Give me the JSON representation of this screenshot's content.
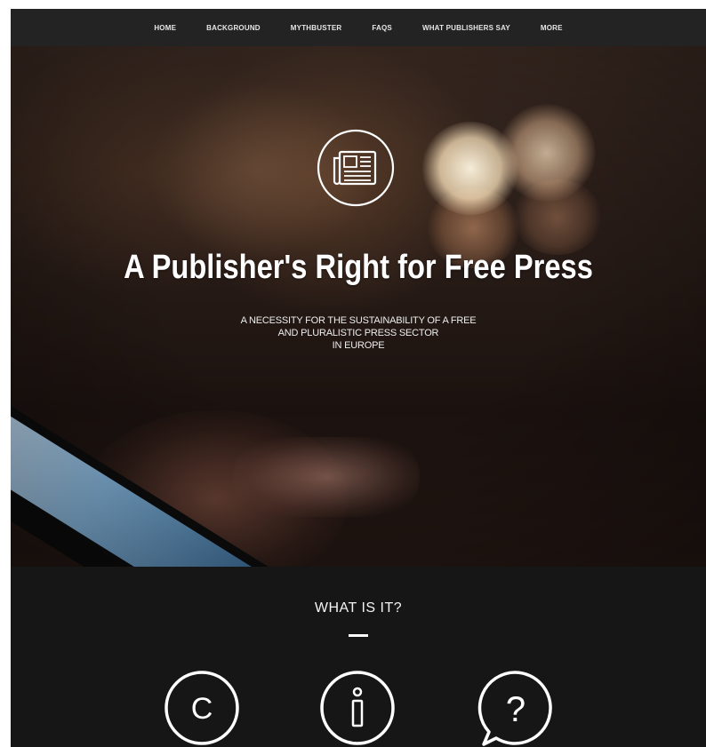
{
  "nav": {
    "items": [
      {
        "label": "HOME"
      },
      {
        "label": "BACKGROUND"
      },
      {
        "label": "MYTHBUSTER"
      },
      {
        "label": "FAQs"
      },
      {
        "label": "WHAT PUBLISHERS SAY"
      },
      {
        "label": "More"
      }
    ]
  },
  "hero": {
    "title": "A Publisher's Right for Free Press",
    "subtitle_lines": [
      "A NECESSITY FOR THE SUSTAINABILITY OF A FREE",
      "AND PLURALISTIC PRESS SECTOR",
      "IN EUROPE"
    ],
    "icon": "newspaper-icon"
  },
  "section": {
    "title": "WHAT IS IT?",
    "icons": [
      "copyright-icon",
      "info-icon",
      "question-bubble-icon"
    ],
    "icon_letters": {
      "copyright": "C",
      "info": "i",
      "question": "?"
    }
  }
}
